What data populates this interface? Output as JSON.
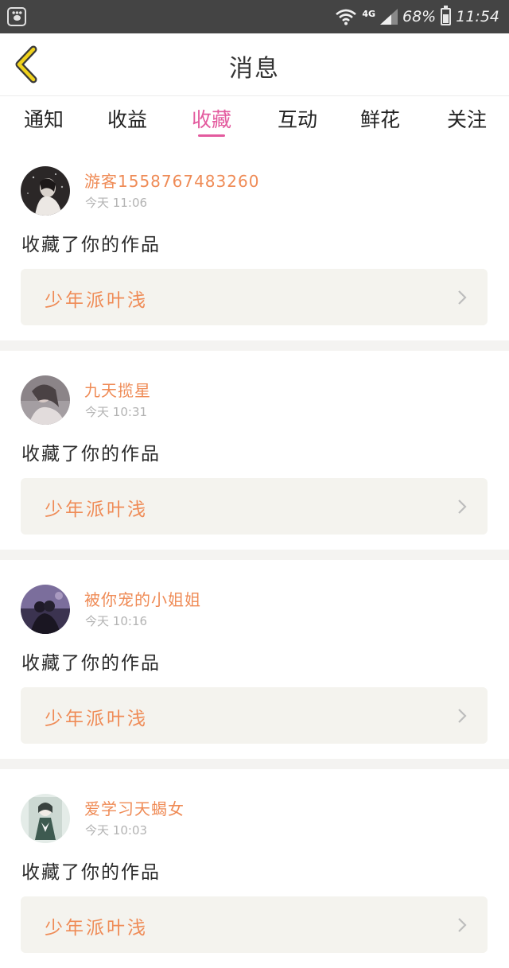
{
  "status_bar": {
    "network": "4G",
    "battery": "68%",
    "battery_level": 0.68,
    "time": "11:54"
  },
  "header": {
    "title": "消息"
  },
  "tabs": [
    {
      "label": "通知",
      "active": false
    },
    {
      "label": "收益",
      "active": false
    },
    {
      "label": "收藏",
      "active": true
    },
    {
      "label": "互动",
      "active": false
    },
    {
      "label": "鲜花",
      "active": false
    },
    {
      "label": "关注",
      "active": false
    }
  ],
  "notifications": [
    {
      "username": "游客1558767483260",
      "date": "今天",
      "time": "11:06",
      "action": "收藏了你的作品",
      "work_title": "少年派叶浅"
    },
    {
      "username": "九天揽星",
      "date": "今天",
      "time": "10:31",
      "action": "收藏了你的作品",
      "work_title": "少年派叶浅"
    },
    {
      "username": "被你宠的小姐姐",
      "date": "今天",
      "time": "10:16",
      "action": "收藏了你的作品",
      "work_title": "少年派叶浅"
    },
    {
      "username": "爱学习天蝎女",
      "date": "今天",
      "time": "10:03",
      "action": "收藏了你的作品",
      "work_title": "少年派叶浅"
    }
  ],
  "colors": {
    "accent_pink": "#e35a9e",
    "name_orange": "#ef8b56",
    "back_arrow": "#f0d21c",
    "status_bar_bg": "#444444"
  }
}
